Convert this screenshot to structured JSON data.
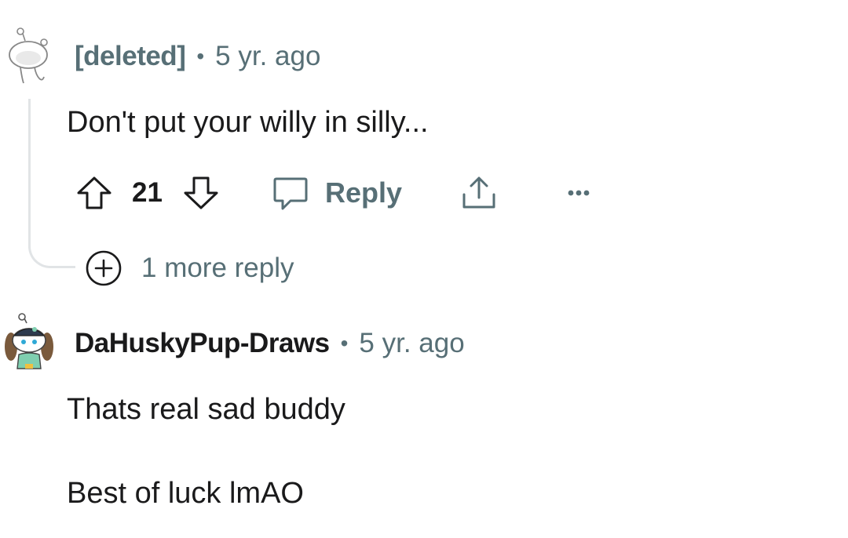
{
  "comments": [
    {
      "username": "[deleted]",
      "age": "5 yr. ago",
      "body_lines": [
        "Don't put your willy in silly..."
      ],
      "score": "21",
      "reply_label": "Reply",
      "more_replies": "1 more reply"
    },
    {
      "username": "DaHuskyPup-Draws",
      "age": "5 yr. ago",
      "body_lines": [
        "Thats real sad buddy",
        "Best of luck lmAO"
      ]
    }
  ],
  "separator": "•",
  "icons": {
    "upvote": "arrow-up-outline",
    "downvote": "arrow-down-outline",
    "reply": "speech-bubble",
    "share": "share-upload",
    "overflow": "three-dots",
    "expand": "plus-circle"
  },
  "colors": {
    "meta_gray": "#576f76",
    "text": "#1a1a1b",
    "thread_line": "#e1e4e6"
  }
}
